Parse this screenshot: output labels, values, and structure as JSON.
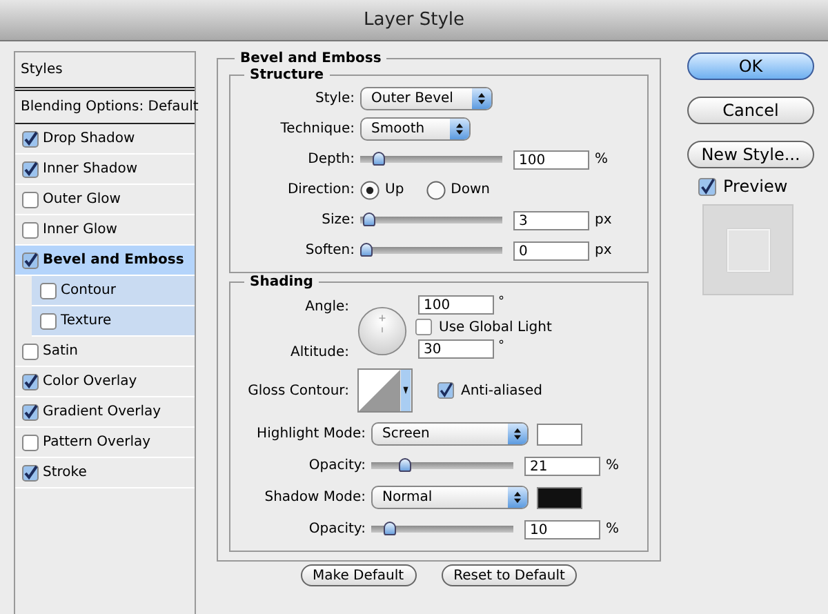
{
  "window": {
    "title": "Layer Style"
  },
  "sidebar": {
    "header": "Styles",
    "blending": {
      "label": "Blending Options: Default",
      "selected": false
    },
    "items": [
      {
        "label": "Drop Shadow",
        "checked": true,
        "selected": false
      },
      {
        "label": "Inner Shadow",
        "checked": true,
        "selected": false
      },
      {
        "label": "Outer Glow",
        "checked": false,
        "selected": false
      },
      {
        "label": "Inner Glow",
        "checked": false,
        "selected": false
      },
      {
        "label": "Bevel and Emboss",
        "checked": true,
        "selected": true,
        "children": [
          {
            "label": "Contour",
            "checked": false,
            "selected": false
          },
          {
            "label": "Texture",
            "checked": false,
            "selected": false
          }
        ]
      },
      {
        "label": "Satin",
        "checked": false,
        "selected": false
      },
      {
        "label": "Color Overlay",
        "checked": true,
        "selected": false
      },
      {
        "label": "Gradient Overlay",
        "checked": true,
        "selected": false
      },
      {
        "label": "Pattern Overlay",
        "checked": false,
        "selected": false
      },
      {
        "label": "Stroke",
        "checked": true,
        "selected": false
      }
    ]
  },
  "bevel": {
    "title": "Bevel and Emboss",
    "structure": {
      "title": "Structure",
      "rows": [
        {
          "kind": "select",
          "label": "Style:",
          "value": "Outer Bevel"
        },
        {
          "kind": "select",
          "label": "Technique:",
          "value": "Smooth"
        },
        {
          "kind": "slider",
          "label": "Depth:",
          "level": 0.1,
          "value": "100",
          "unit": "%"
        },
        {
          "kind": "radio",
          "label": "Direction:",
          "options": [
            {
              "label": "Up",
              "selected": true
            },
            {
              "label": "Down",
              "selected": false
            }
          ]
        },
        {
          "kind": "slider",
          "label": "Size:",
          "level": 0.02,
          "value": "3",
          "unit": "px"
        },
        {
          "kind": "slider",
          "label": "Soften:",
          "level": 0,
          "value": "0",
          "unit": "px"
        }
      ]
    },
    "shading": {
      "title": "Shading",
      "angle": {
        "label": "Angle:",
        "value": "100",
        "unit": "°"
      },
      "global_light": {
        "label": "Use Global Light",
        "checked": false
      },
      "altitude": {
        "label": "Altitude:",
        "value": "30",
        "unit": "°"
      },
      "gloss_contour": {
        "label": "Gloss Contour:"
      },
      "anti_aliased": {
        "label": "Anti-aliased",
        "checked": true
      },
      "rows": [
        {
          "kind": "mode",
          "label": "Highlight Mode:",
          "value": "Screen",
          "color": "#ffffff"
        },
        {
          "kind": "slider",
          "label": "Opacity:",
          "level": 0.21,
          "value": "21",
          "unit": "%"
        },
        {
          "kind": "mode",
          "label": "Shadow Mode:",
          "value": "Normal",
          "color": "#111111"
        },
        {
          "kind": "slider",
          "label": "Opacity:",
          "level": 0.1,
          "value": "10",
          "unit": "%"
        }
      ]
    },
    "buttons": [
      {
        "label": "Make Default"
      },
      {
        "label": "Reset to Default"
      }
    ]
  },
  "actions": [
    {
      "label": "OK",
      "default": true
    },
    {
      "label": "Cancel",
      "default": false
    },
    {
      "label": "New Style...",
      "default": false
    }
  ],
  "preview": {
    "label": "Preview",
    "checked": true
  }
}
